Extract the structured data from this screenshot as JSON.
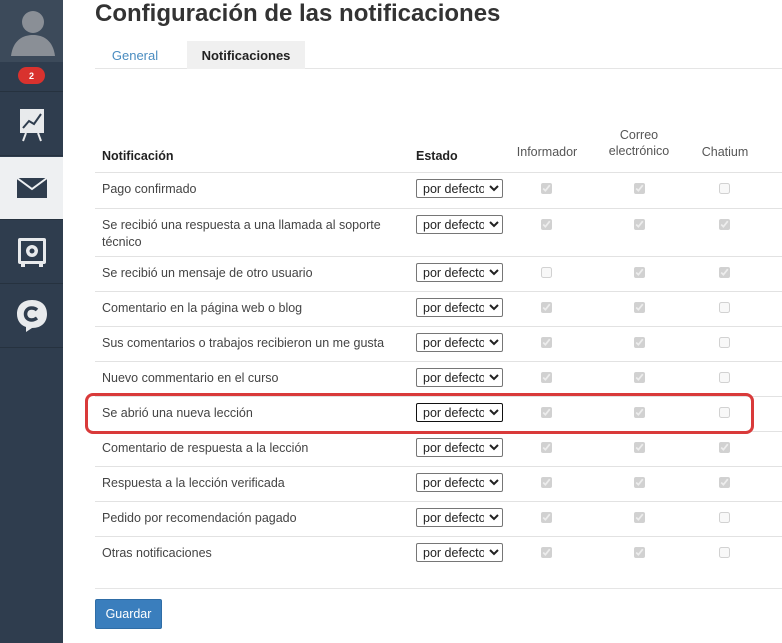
{
  "sidebar": {
    "badge_count": "2",
    "items": [
      {
        "name": "stats",
        "icon": "chart-board-icon"
      },
      {
        "name": "messages",
        "icon": "envelope-icon",
        "active": true
      },
      {
        "name": "safe",
        "icon": "safe-icon"
      },
      {
        "name": "chatium",
        "icon": "chatium-logo-icon"
      }
    ]
  },
  "page": {
    "title": "Configuración de las notificaciones"
  },
  "tabs": {
    "general": "General",
    "notifications": "Notificaciones"
  },
  "table": {
    "headers": {
      "notification": "Notificación",
      "status": "Estado",
      "informer": "Informador",
      "email_line1": "Correo",
      "email_line2": "electrónico",
      "chatium": "Chatium"
    },
    "rows": [
      {
        "label": "Pago confirmado",
        "status": "por defecto",
        "informer": true,
        "email": true,
        "chatium": false
      },
      {
        "label": "Se recibió una respuesta a una llamada al soporte técnico",
        "status": "por defecto",
        "informer": true,
        "email": true,
        "chatium": true
      },
      {
        "label": "Se recibió un mensaje de otro usuario",
        "status": "por defecto",
        "informer": false,
        "email": true,
        "chatium": true
      },
      {
        "label": "Comentario en la página web o blog",
        "status": "por defecto",
        "informer": true,
        "email": true,
        "chatium": false
      },
      {
        "label": "Sus comentarios o trabajos recibieron un me gusta",
        "status": "por defecto",
        "informer": true,
        "email": true,
        "chatium": false
      },
      {
        "label": "Nuevo commentario en el curso",
        "status": "por defecto",
        "informer": true,
        "email": true,
        "chatium": false
      },
      {
        "label": "Se abrió una nueva lección",
        "status": "por defecto",
        "informer": true,
        "email": true,
        "chatium": false,
        "highlighted": true
      },
      {
        "label": "Comentario de respuesta a la lección",
        "status": "por defecto",
        "informer": true,
        "email": true,
        "chatium": true
      },
      {
        "label": "Respuesta a la lección verificada",
        "status": "por defecto",
        "informer": true,
        "email": true,
        "chatium": true
      },
      {
        "label": "Pedido por recomendación pagado",
        "status": "por defecto",
        "informer": true,
        "email": true,
        "chatium": false
      },
      {
        "label": "Otras notificaciones",
        "status": "por defecto",
        "informer": true,
        "email": true,
        "chatium": false
      }
    ]
  },
  "actions": {
    "save": "Guardar"
  },
  "colors": {
    "sidebar_bg": "#2f3d4e",
    "badge": "#d9322e",
    "accent": "#3a7ebd",
    "highlight": "#d93a3a"
  }
}
